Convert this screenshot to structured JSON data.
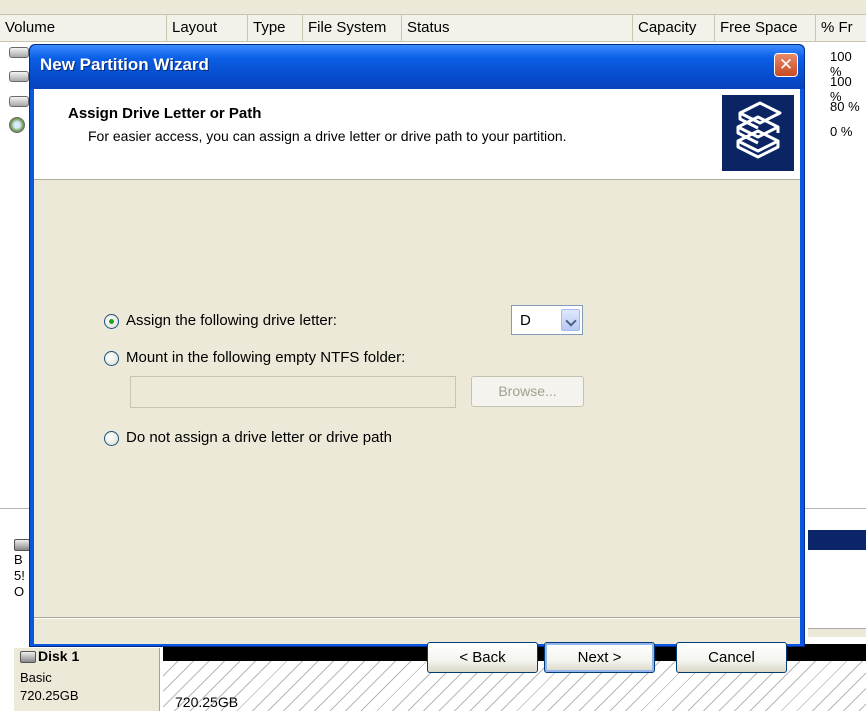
{
  "background": {
    "columns": [
      "Volume",
      "Layout",
      "Type",
      "File System",
      "Status",
      "Capacity",
      "Free Space",
      "% Fr"
    ],
    "percent_free": [
      "100 %",
      "100 %",
      "80 %",
      "0 %"
    ],
    "left_stub_lines": [
      "B",
      "5!",
      "O"
    ],
    "disk1": {
      "name": "Disk 1",
      "type": "Basic",
      "size": "720.25GB",
      "partition_size": "720.25GB"
    }
  },
  "dialog": {
    "title": "New Partition Wizard",
    "close_label": "✕",
    "header": {
      "title": "Assign Drive Letter or Path",
      "subtitle": "For easier access, you can assign a drive letter or drive path to your partition."
    },
    "options": {
      "assign_letter": "Assign the following drive letter:",
      "mount_folder": "Mount in the following empty NTFS folder:",
      "no_assign": "Do not assign a drive letter or drive path"
    },
    "selected_option": "assign_letter",
    "drive_letter": "D",
    "folder_path": "",
    "browse_label": "Browse...",
    "buttons": {
      "back": "< Back",
      "next": "Next >",
      "cancel": "Cancel"
    }
  }
}
